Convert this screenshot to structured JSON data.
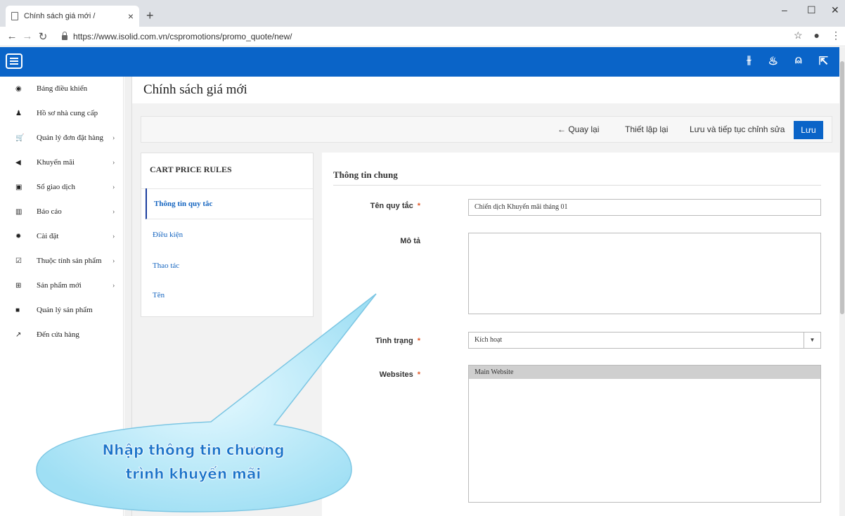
{
  "browser": {
    "tab_title": "Chính sách giá mới /",
    "tab_close": "×",
    "new_tab": "+",
    "url": "https://www.isolid.com.vn/cspromotions/promo_quote/new/",
    "controls": {
      "minimize": "–",
      "maximize": "☐",
      "close": "✕"
    }
  },
  "sidebar": {
    "items": [
      {
        "icon": "dashboard-icon",
        "glyph": "◉",
        "label": "Bảng điều khiển",
        "chevron": ""
      },
      {
        "icon": "user-icon",
        "glyph": "♟",
        "label": "Hồ sơ nhà cung cấp",
        "chevron": ""
      },
      {
        "icon": "cart-icon",
        "glyph": "🛒",
        "label": "Quản lý đơn đặt hàng",
        "chevron": "›"
      },
      {
        "icon": "megaphone-icon",
        "glyph": "◀",
        "label": "Khuyến mãi",
        "chevron": "›"
      },
      {
        "icon": "money-icon",
        "glyph": "▣",
        "label": "Sổ giao dịch",
        "chevron": "›"
      },
      {
        "icon": "bar-chart-icon",
        "glyph": "▥",
        "label": "Báo cáo",
        "chevron": "›"
      },
      {
        "icon": "gear-icon",
        "glyph": "✹",
        "label": "Cài đặt",
        "chevron": "›"
      },
      {
        "icon": "checkbox-icon",
        "glyph": "☑",
        "label": "Thuộc tính sản phẩm",
        "chevron": "›"
      },
      {
        "icon": "plus-square-icon",
        "glyph": "⊞",
        "label": "Sản phẩm mới",
        "chevron": "›"
      },
      {
        "icon": "folder-icon",
        "glyph": "■",
        "label": "Quản lý sản phẩm",
        "chevron": ""
      },
      {
        "icon": "external-link-icon",
        "glyph": "↗",
        "label": "Đến cửa hàng",
        "chevron": ""
      }
    ]
  },
  "page": {
    "title": "Chính sách giá mới",
    "actions": {
      "back": "← Quay lại",
      "reset": "Thiết lập lại",
      "save_continue": "Lưu và tiếp tục chỉnh sửa",
      "save": "Lưu"
    }
  },
  "rules_panel": {
    "title": "CART PRICE RULES",
    "tabs": [
      "Thông tin quy tắc",
      "Điều kiện",
      "Thao tác",
      "Tên"
    ]
  },
  "form": {
    "section_title": "Thông tin chung",
    "rule_name_label": "Tên quy tắc",
    "rule_name_value": "Chiến dịch Khuyến mãi tháng 01",
    "description_label": "Mô tả",
    "description_value": "",
    "status_label": "Tình trạng",
    "status_value": "Kích hoạt",
    "websites_label": "Websites",
    "websites_options": [
      "Main Website"
    ],
    "required_mark": "*"
  },
  "callout": {
    "line1": "Nhập thông tin chương",
    "line2": "trình khuyến mãi",
    "fill_color": "#a8e4f7",
    "text_color": "#1a73c9"
  }
}
